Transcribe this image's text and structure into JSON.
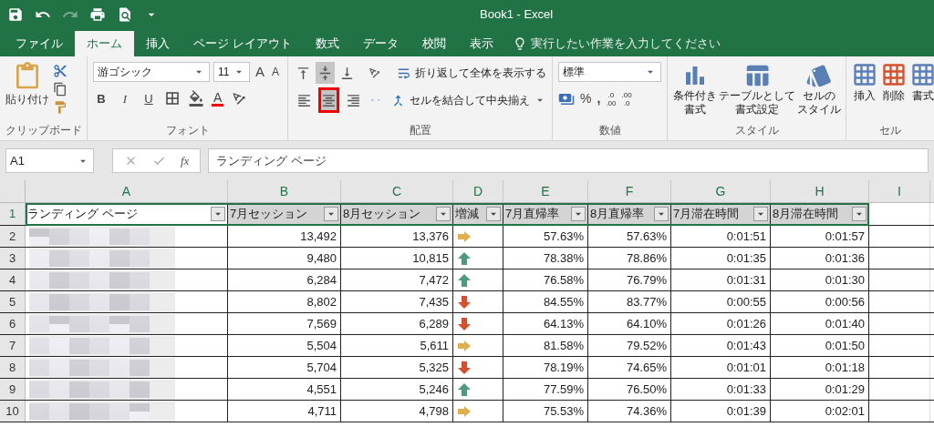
{
  "window": {
    "title": "Book1 - Excel"
  },
  "ribbon_tabs": [
    {
      "label": "ファイル",
      "selected": false
    },
    {
      "label": "ホーム",
      "selected": true
    },
    {
      "label": "挿入",
      "selected": false
    },
    {
      "label": "ページ レイアウト",
      "selected": false
    },
    {
      "label": "数式",
      "selected": false
    },
    {
      "label": "データ",
      "selected": false
    },
    {
      "label": "校閲",
      "selected": false
    },
    {
      "label": "表示",
      "selected": false
    }
  ],
  "tell_me": {
    "placeholder": "実行したい作業を入力してください"
  },
  "clipboard": {
    "paste_label": "貼り付け",
    "group_label": "クリップボード"
  },
  "font": {
    "name": "游ゴシック",
    "size": "11",
    "grow_label": "A",
    "shrink_label": "A",
    "style_buttons": [
      "B",
      "I",
      "U"
    ],
    "font_color_label": "A",
    "group_label": "フォント"
  },
  "alignment": {
    "vertical": [
      {
        "kind": "top",
        "selected": false
      },
      {
        "kind": "middle",
        "selected": true
      },
      {
        "kind": "bottom",
        "selected": false
      }
    ],
    "horizontal": [
      {
        "kind": "left",
        "selected": false
      },
      {
        "kind": "center",
        "selected": true,
        "highlighted": true
      },
      {
        "kind": "right",
        "selected": false
      }
    ],
    "wrap_label": "折り返して全体を表示する",
    "merge_label": "セルを結合して中央揃え",
    "group_label": "配置"
  },
  "number": {
    "format": "標準",
    "percent": "%",
    "comma": ",",
    "decimals": [
      {
        "top": ".0",
        "bottom": ".00"
      },
      {
        "top": ".00",
        "bottom": ".0"
      }
    ],
    "group_label": "数値"
  },
  "styles": {
    "buttons": [
      {
        "kind": "conditional",
        "lines": [
          "条件付き",
          "書式"
        ]
      },
      {
        "kind": "table",
        "lines": [
          "テーブルとして",
          "書式設定"
        ]
      },
      {
        "kind": "cell",
        "lines": [
          "セルの",
          "スタイル"
        ]
      }
    ],
    "group_label": "スタイル"
  },
  "cells": {
    "buttons": [
      {
        "kind": "insert",
        "label": "挿入"
      },
      {
        "kind": "delete",
        "label": "削除"
      },
      {
        "kind": "format",
        "label": "書式"
      }
    ],
    "group_label": "セル"
  },
  "formula_bar": {
    "name_box": "A1",
    "function_label": "fx",
    "content": "ランディング ページ"
  },
  "sheet": {
    "columns": [
      "A",
      "B",
      "C",
      "D",
      "E",
      "F",
      "G",
      "H",
      "I"
    ],
    "header_row": {
      "number": "1",
      "cells": [
        "ランディング ページ",
        "7月セッション",
        "8月セッション",
        "増減",
        "7月直帰率",
        "8月直帰率",
        "7月滞在時間",
        "8月滞在時間"
      ]
    },
    "rows": [
      {
        "number": "2",
        "b": "13,492",
        "c": "13,376",
        "trend": {
          "kind": "flat",
          "color": "#e0b050"
        },
        "e": "57.63%",
        "f": "57.63%",
        "g": "0:01:51",
        "h": "0:01:57"
      },
      {
        "number": "3",
        "b": "9,480",
        "c": "10,815",
        "trend": {
          "kind": "up",
          "color": "#4f9a7e"
        },
        "e": "78.38%",
        "f": "78.86%",
        "g": "0:01:35",
        "h": "0:01:36"
      },
      {
        "number": "4",
        "b": "6,284",
        "c": "7,472",
        "trend": {
          "kind": "up",
          "color": "#4f9a7e"
        },
        "e": "76.58%",
        "f": "76.79%",
        "g": "0:01:31",
        "h": "0:01:30"
      },
      {
        "number": "5",
        "b": "8,802",
        "c": "7,435",
        "trend": {
          "kind": "down",
          "color": "#d5502c"
        },
        "e": "84.55%",
        "f": "83.77%",
        "g": "0:00:55",
        "h": "0:00:56"
      },
      {
        "number": "6",
        "b": "7,569",
        "c": "6,289",
        "trend": {
          "kind": "down",
          "color": "#d5502c"
        },
        "e": "64.13%",
        "f": "64.10%",
        "g": "0:01:26",
        "h": "0:01:40"
      },
      {
        "number": "7",
        "b": "5,504",
        "c": "5,611",
        "trend": {
          "kind": "flat",
          "color": "#e0b050"
        },
        "e": "81.58%",
        "f": "79.52%",
        "g": "0:01:43",
        "h": "0:01:50"
      },
      {
        "number": "8",
        "b": "5,704",
        "c": "5,325",
        "trend": {
          "kind": "down",
          "color": "#d5502c"
        },
        "e": "78.19%",
        "f": "74.65%",
        "g": "0:01:01",
        "h": "0:01:18"
      },
      {
        "number": "9",
        "b": "4,551",
        "c": "5,246",
        "trend": {
          "kind": "up",
          "color": "#4f9a7e"
        },
        "e": "77.59%",
        "f": "76.50%",
        "g": "0:01:33",
        "h": "0:01:29"
      },
      {
        "number": "10",
        "b": "4,711",
        "c": "4,798",
        "trend": {
          "kind": "flat",
          "color": "#e0b050"
        },
        "e": "75.53%",
        "f": "74.36%",
        "g": "0:01:39",
        "h": "0:02:01"
      }
    ]
  }
}
